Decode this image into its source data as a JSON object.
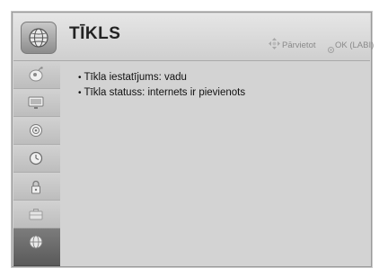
{
  "header": {
    "icon": "network-globe-icon",
    "title": "TĪKLS",
    "hints": [
      {
        "icon": "four-way-arrows-icon",
        "label": "Pārvietot"
      },
      {
        "icon": "ok-circle-icon",
        "label": "OK (LABI)"
      }
    ]
  },
  "sidebar": {
    "items": [
      {
        "icon": "picture-satellite-icon",
        "active": false
      },
      {
        "icon": "tv-screen-icon",
        "active": false
      },
      {
        "icon": "audio-speaker-icon",
        "active": false
      },
      {
        "icon": "clock-icon",
        "active": false
      },
      {
        "icon": "lock-icon",
        "active": false
      },
      {
        "icon": "briefcase-icon",
        "active": false
      },
      {
        "icon": "network-globe-icon",
        "active": true
      }
    ]
  },
  "content": {
    "items": [
      {
        "bullet": "•",
        "text": "Tīkla iestatījums: vadu"
      },
      {
        "bullet": "•",
        "text": "Tīkla statuss: internets ir pievienots"
      }
    ]
  },
  "colors": {
    "panel_background": "#d3d3d3",
    "active_sidebar": "#6a6a6a",
    "hint_text": "#8a8a8a"
  }
}
